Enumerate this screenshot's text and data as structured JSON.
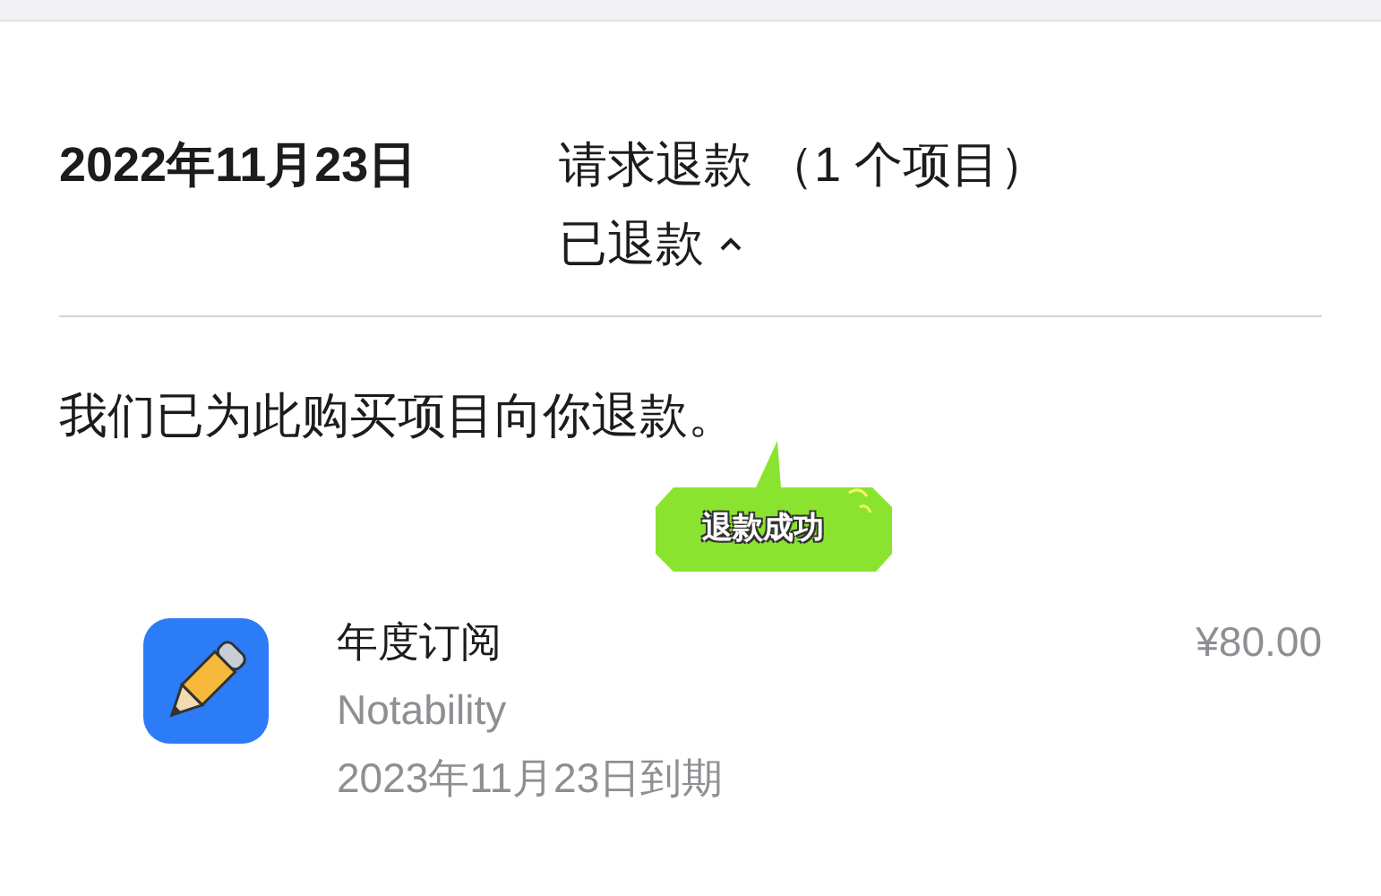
{
  "header": {
    "date": "2022年11月23日",
    "title": "请求退款 （1 个项目）",
    "status": "已退款",
    "expanded": true
  },
  "message": "我们已为此购买项目向你退款。",
  "sticker": {
    "label": "退款成功"
  },
  "item": {
    "name": "年度订阅",
    "app": "Notability",
    "expiry": "2023年11月23日到期",
    "price": "¥80.00"
  }
}
